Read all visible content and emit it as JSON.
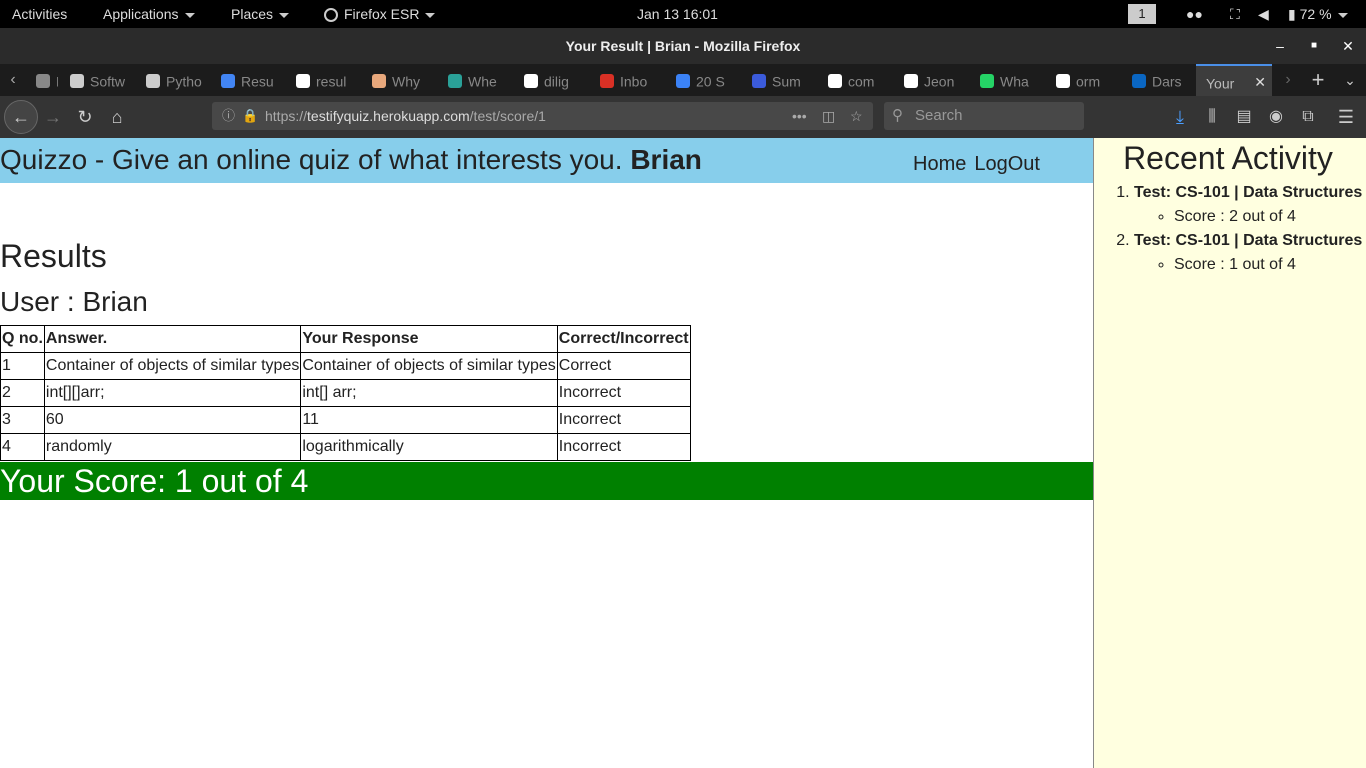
{
  "system_bar": {
    "activities": "Activities",
    "applications": "Applications",
    "places": "Places",
    "firefox": "Firefox ESR",
    "datetime": "Jan 13  16:01",
    "workspace": "1",
    "battery": "72 %"
  },
  "window": {
    "title": "Your Result | Brian - Mozilla Firefox"
  },
  "tabs": [
    {
      "label": "Ers",
      "icon": "page-icon",
      "color": "#888888"
    },
    {
      "label": "Softw",
      "icon": "peace-icon",
      "color": "#cccccc"
    },
    {
      "label": "Pytho",
      "icon": "peace-icon",
      "color": "#cccccc"
    },
    {
      "label": "Resu",
      "icon": "docs-icon",
      "color": "#4285f4"
    },
    {
      "label": "resul",
      "icon": "google-icon",
      "color": "#ffffff"
    },
    {
      "label": "Why",
      "icon": "hand-icon",
      "color": "#e8a87c"
    },
    {
      "label": "Whe",
      "icon": "medium-icon",
      "color": "#2aa198"
    },
    {
      "label": "dilig",
      "icon": "google-icon",
      "color": "#ffffff"
    },
    {
      "label": "Inbo",
      "icon": "gmail-icon",
      "color": "#d93025"
    },
    {
      "label": "20 S",
      "icon": "stack-icon",
      "color": "#3b82f6"
    },
    {
      "label": "Sum",
      "icon": "stack-icon",
      "color": "#3b5bdb"
    },
    {
      "label": "com",
      "icon": "google-icon",
      "color": "#ffffff"
    },
    {
      "label": "Jeon",
      "icon": "google-icon",
      "color": "#ffffff"
    },
    {
      "label": "Wha",
      "icon": "whatsapp-icon",
      "color": "#25d366"
    },
    {
      "label": "orm",
      "icon": "google-icon",
      "color": "#ffffff"
    },
    {
      "label": "Dars",
      "icon": "linkedin-icon",
      "color": "#0a66c2"
    },
    {
      "label": "Your",
      "icon": "",
      "color": "#bbbbbb",
      "active": true
    }
  ],
  "address": {
    "prefix": "https://",
    "host": "testifyquiz.herokuapp.com",
    "path": "/test/score/1"
  },
  "search": {
    "placeholder": "Search"
  },
  "page": {
    "brand": "Quizzo - Give an online quiz of what interests you.",
    "username": "Brian",
    "nav": {
      "home": "Home",
      "logout": "LogOut"
    },
    "results_title": "Results",
    "user_line": "User : Brian",
    "table": {
      "headers": [
        "Q no.",
        "Answer.",
        "Your Response",
        "Correct/Incorrect"
      ],
      "rows": [
        [
          "1",
          "Container of objects of similar types",
          "Container of objects of similar types",
          "Correct"
        ],
        [
          "2",
          "int[][]arr;",
          "int[] arr;",
          "Incorrect"
        ],
        [
          "3",
          "60",
          "11",
          "Incorrect"
        ],
        [
          "4",
          "randomly",
          "logarithmically",
          "Incorrect"
        ]
      ]
    },
    "score": "Your Score: 1 out of 4"
  },
  "sidebar": {
    "title": "Recent Activity",
    "items": [
      {
        "test": "Test: CS-101 | Data Structures",
        "score": "Score : 2 out of 4"
      },
      {
        "test": "Test: CS-101 | Data Structures",
        "score": "Score : 1 out of 4"
      }
    ]
  },
  "colors": {
    "header_bg": "#87ceeb",
    "score_bg": "#008000",
    "sidebar_bg": "#ffffe0"
  }
}
